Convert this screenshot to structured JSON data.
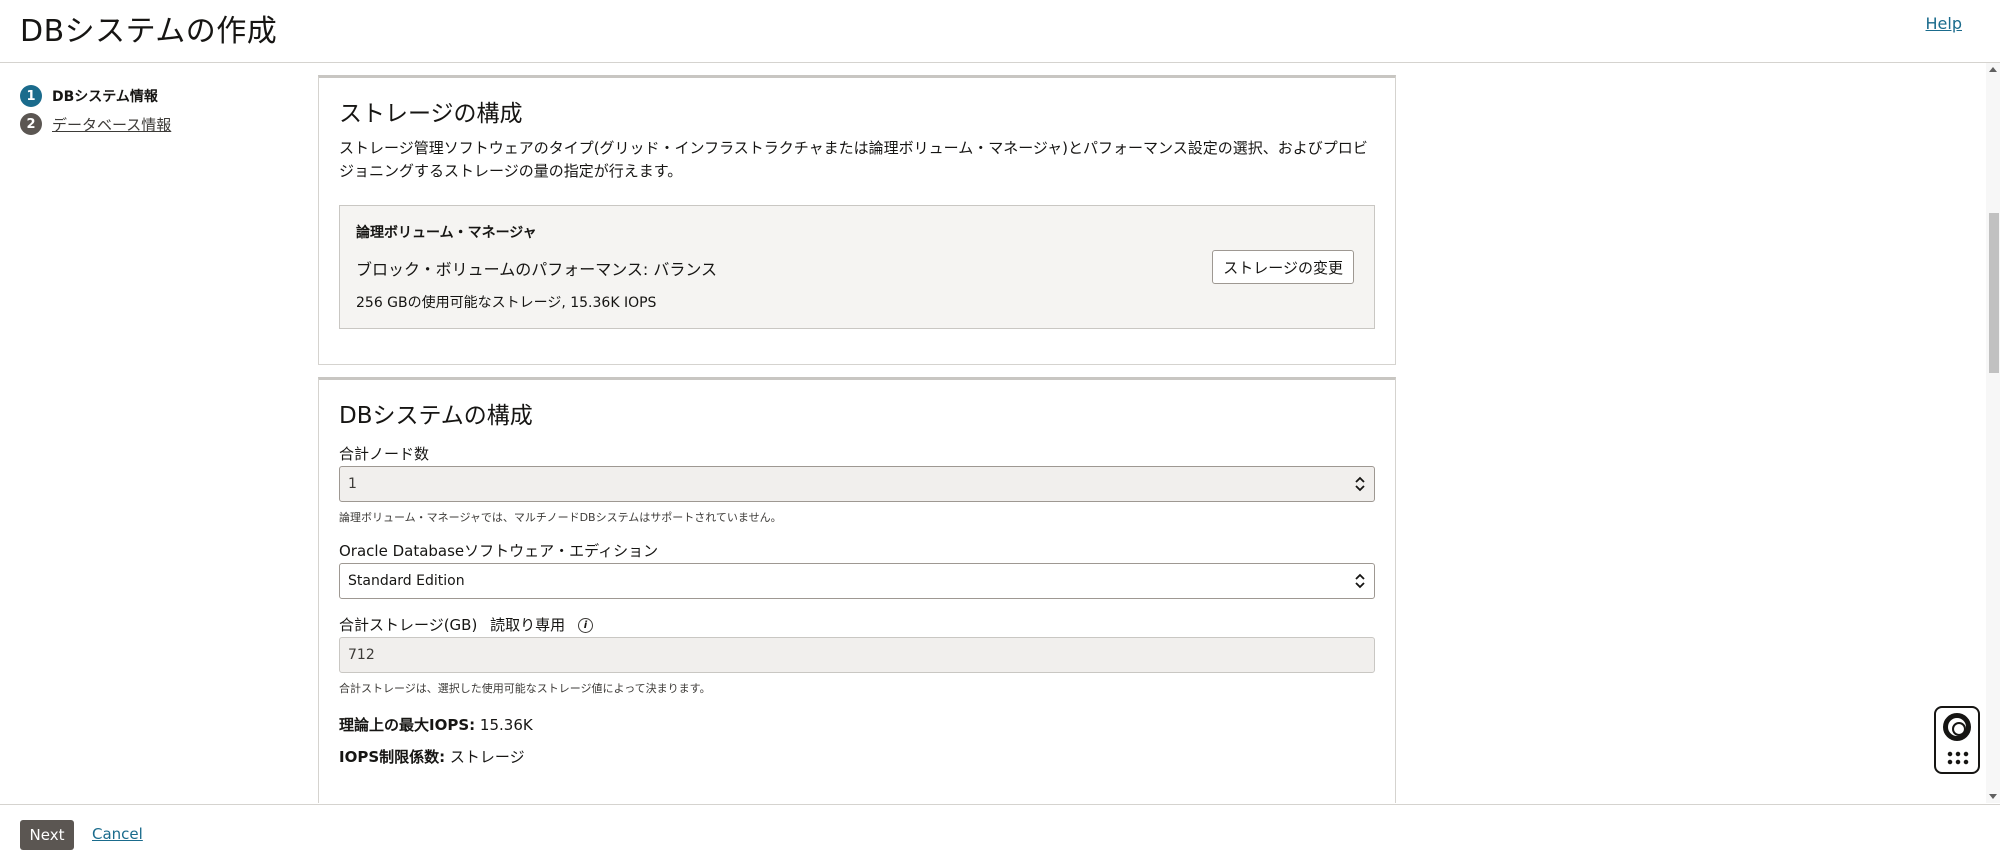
{
  "header": {
    "title": "DBシステムの作成",
    "help": "Help"
  },
  "steps": [
    {
      "num": "1",
      "label": "DBシステム情報"
    },
    {
      "num": "2",
      "label": "データベース情報"
    }
  ],
  "storage": {
    "title": "ストレージの構成",
    "description": "ストレージ管理ソフトウェアのタイプ(グリッド・インフラストラクチャまたは論理ボリューム・マネージャ)とパフォーマンス設定の選択、およびプロビジョニングするストレージの量の指定が行えます。",
    "box_title": "論理ボリューム・マネージャ",
    "performance": "ブロック・ボリュームのパフォーマンス: バランス",
    "capacity": "256 GBの使用可能なストレージ, 15.36K IOPS",
    "change_button": "ストレージの変更"
  },
  "db_config": {
    "title": "DBシステムの構成",
    "nodes_label": "合計ノード数",
    "nodes_value": "1",
    "nodes_help": "論理ボリューム・マネージャでは、マルチノードDBシステムはサポートされていません。",
    "edition_label": "Oracle Databaseソフトウェア・エディション",
    "edition_value": "Standard Edition",
    "total_storage_label": "合計ストレージ(GB)",
    "readonly_label": "読取り専用",
    "total_storage_value": "712",
    "total_storage_help": "合計ストレージは、選択した使用可能なストレージ値によって決まります。",
    "max_iops_label": "理論上の最大IOPS:",
    "max_iops_value": "15.36K",
    "iops_limit_label": "IOPS制限係数:",
    "iops_limit_value": "ストレージ"
  },
  "footer": {
    "next": "Next",
    "cancel": "Cancel"
  },
  "icons": {
    "help_widget": "lifebuoy-icon",
    "info": "info-icon"
  },
  "colors": {
    "accent": "#1a6b8c",
    "next_button": "#5b5652"
  }
}
